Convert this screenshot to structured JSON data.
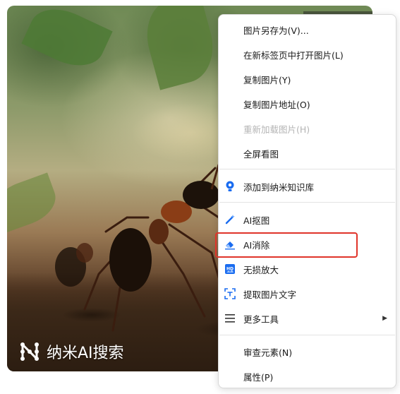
{
  "image": {
    "brand_text": "纳米AI搜索",
    "logo_icon": "nami-logo-icon"
  },
  "menu": {
    "items": [
      {
        "label": "图片另存为(V)...",
        "enabled": true
      },
      {
        "label": "在新标签页中打开图片(L)",
        "enabled": true
      },
      {
        "label": "复制图片(Y)",
        "enabled": true
      },
      {
        "label": "复制图片地址(O)",
        "enabled": true
      },
      {
        "label": "重新加载图片(H)",
        "enabled": false
      },
      {
        "label": "全屏看图",
        "enabled": true
      },
      {
        "label": "添加到纳米知识库",
        "icon": "knowledge-base-icon",
        "enabled": true
      },
      {
        "label": "AI抠图",
        "icon": "magic-wand-icon",
        "enabled": true
      },
      {
        "label": "AI消除",
        "icon": "eraser-icon",
        "enabled": true,
        "highlighted": true
      },
      {
        "label": "无损放大",
        "icon": "hd-upscale-icon",
        "enabled": true
      },
      {
        "label": "提取图片文字",
        "icon": "text-extract-icon",
        "enabled": true
      },
      {
        "label": "更多工具",
        "icon": "hamburger-icon",
        "has_submenu": true,
        "enabled": true
      },
      {
        "label": "审查元素(N)",
        "enabled": true
      },
      {
        "label": "属性(P)",
        "enabled": true
      }
    ]
  },
  "colors": {
    "highlight_border": "#e0342a",
    "icon_blue": "#1a6cf0",
    "disabled_text": "#b4b4b4"
  }
}
